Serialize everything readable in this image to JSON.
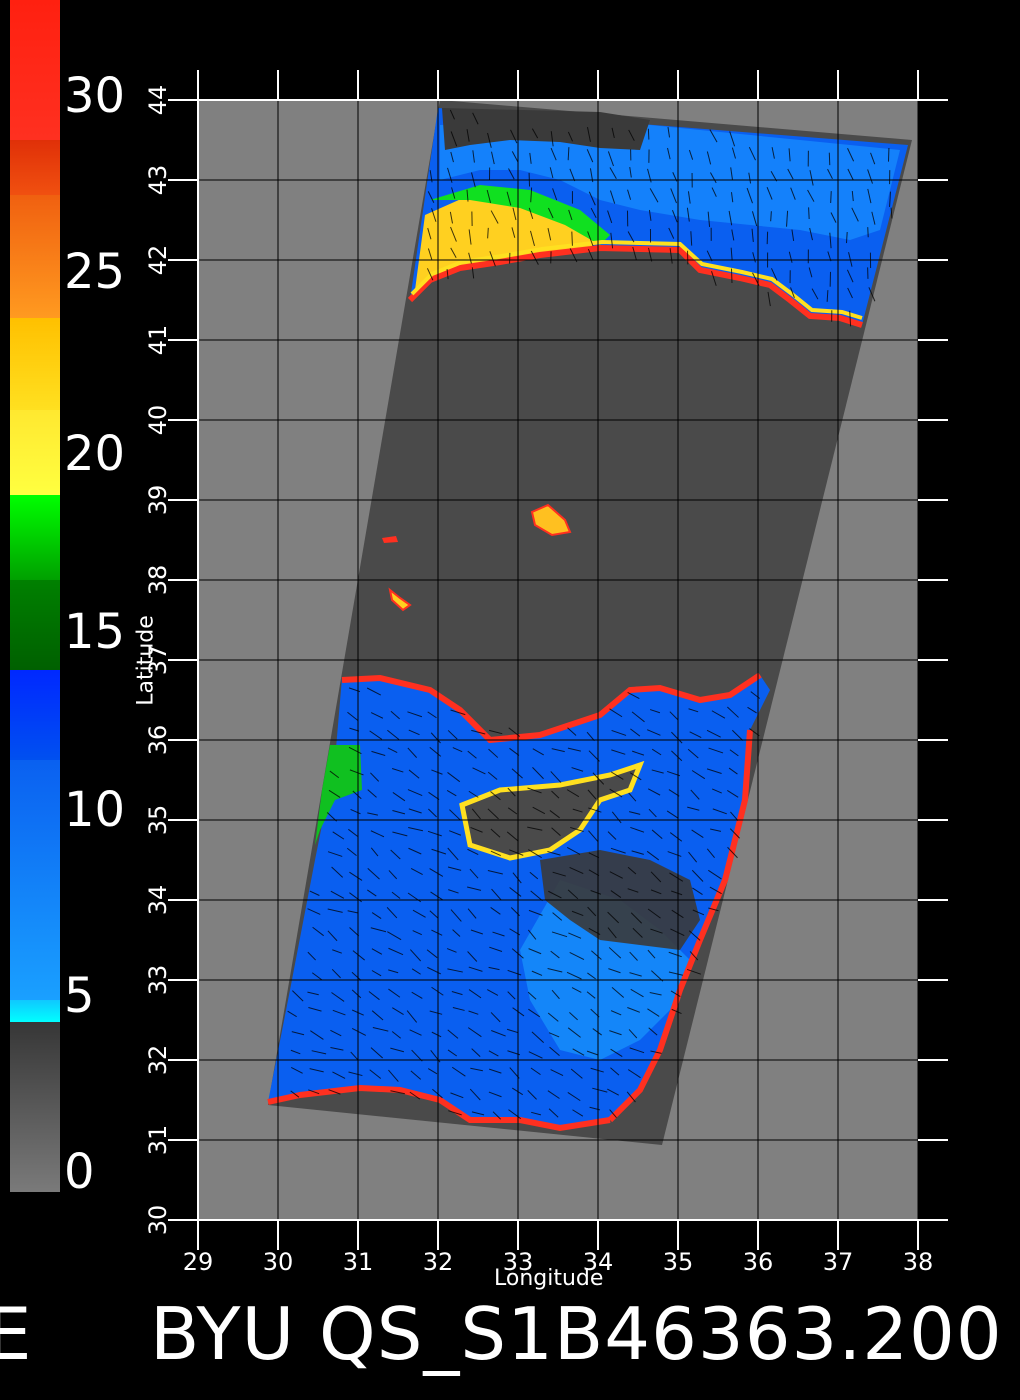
{
  "colorbar": {
    "labels": [
      "30",
      "25",
      "20",
      "15",
      "10",
      "5",
      "0"
    ],
    "stops": [
      {
        "color": "#ff1a10"
      },
      {
        "color": "#e84010"
      },
      {
        "color": "#ff8c1a"
      },
      {
        "color": "#ffd000"
      },
      {
        "color": "#ffff30"
      },
      {
        "color": "#00ff00"
      },
      {
        "color": "#007000"
      },
      {
        "color": "#0028ff"
      },
      {
        "color": "#1a8cff"
      },
      {
        "color": "#00ffff"
      },
      {
        "color": "#3a3a3a"
      },
      {
        "color": "#6e6e6e"
      }
    ]
  },
  "axes": {
    "xlabel": "Longitude",
    "ylabel": "Latitude",
    "lon_ticks": [
      "29",
      "30",
      "31",
      "32",
      "33",
      "34",
      "35",
      "36",
      "37",
      "38"
    ],
    "lat_ticks": [
      "30",
      "31",
      "32",
      "33",
      "34",
      "35",
      "36",
      "37",
      "38",
      "39",
      "40",
      "41",
      "42",
      "43",
      "44"
    ]
  },
  "footer": {
    "left_char": "E",
    "text": "BYU QS_S1B46363.200"
  },
  "colors": {
    "background": "#000000",
    "land": "#808080",
    "swath": "#4a4a4a",
    "grid": "#000000",
    "ticks": "#ffffff"
  }
}
